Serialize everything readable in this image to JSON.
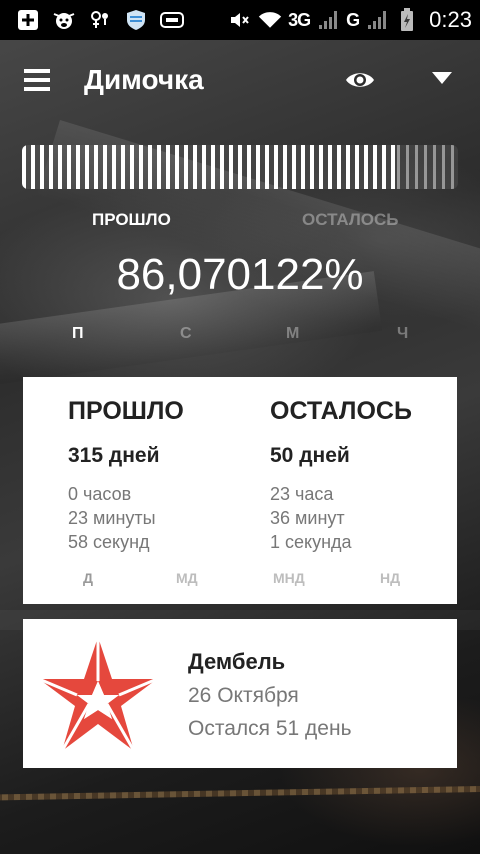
{
  "status_bar": {
    "network": "3G",
    "carrier_label": "G",
    "time": "0:23",
    "icons": [
      "plus-square-icon",
      "cow-icon",
      "notification-icon",
      "shield-icon",
      "gamepad-icon",
      "mute-icon",
      "wifi-icon",
      "signal-icon",
      "battery-charging-icon"
    ]
  },
  "app": {
    "title": "Димочка"
  },
  "progress": {
    "passed_fraction": 0.8607,
    "tab_passed": "ПРОШЛО",
    "tab_remaining": "ОСТАЛОСЬ",
    "percent_text": "86,070122%",
    "units": [
      "П",
      "С",
      "М",
      "Ч"
    ]
  },
  "stats": {
    "passed": {
      "heading": "ПРОШЛО",
      "days": "315 дней",
      "hours": "0 часов",
      "minutes": "23 минуты",
      "seconds": "58 секунд"
    },
    "remaining": {
      "heading": "ОСТАЛОСЬ",
      "days": "50 дней",
      "hours": "23 часа",
      "minutes": "36 минут",
      "seconds": "1 секунда"
    },
    "modes": [
      "Д",
      "МД",
      "МНД",
      "НД"
    ]
  },
  "event": {
    "title": "Дембель",
    "date": "26 Октября",
    "remaining": "Остался 51 день"
  },
  "colors": {
    "star_red": "#e5483d",
    "card_bg": "#ffffff"
  }
}
